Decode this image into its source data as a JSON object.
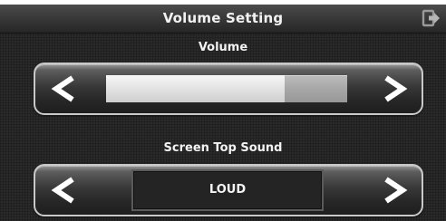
{
  "window": {
    "title": "Volume Setting",
    "exit_icon": "exit-arrow-icon"
  },
  "volume": {
    "label": "Volume",
    "level_fraction": 0.74,
    "decrease_icon": "left-arrow-icon",
    "increase_icon": "right-arrow-icon"
  },
  "screen_top_sound": {
    "label": "Screen Top Sound",
    "value": "LOUD",
    "previous_icon": "left-arrow-icon",
    "next_icon": "right-arrow-icon"
  },
  "colors": {
    "background": "#2a2a2a",
    "text": "#f2f2f2",
    "slider_fill": "#e4e4e4",
    "slider_track": "#a7a7a7"
  }
}
